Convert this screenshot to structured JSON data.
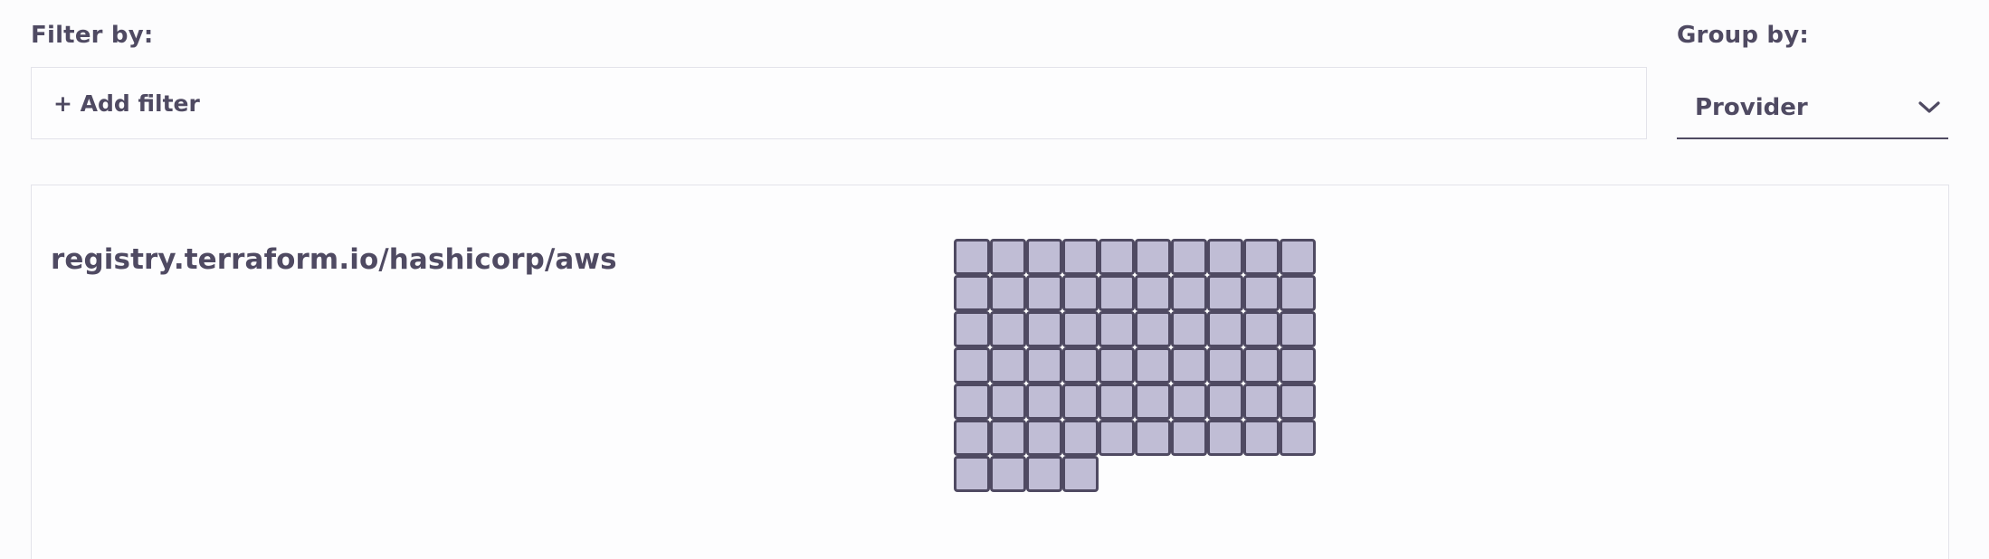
{
  "filter": {
    "label": "Filter by:",
    "add_filter": "+ Add filter"
  },
  "group": {
    "label": "Group by:",
    "selected": "Provider"
  },
  "providers": [
    {
      "name": "registry.terraform.io/hashicorp/aws",
      "resource_count": 64
    }
  ],
  "colors": {
    "cell_fill": "#c0bdd5",
    "cell_border": "#4f4a62",
    "text": "#4f4a62"
  },
  "icons": {
    "group_select": "chevron-down-icon"
  }
}
